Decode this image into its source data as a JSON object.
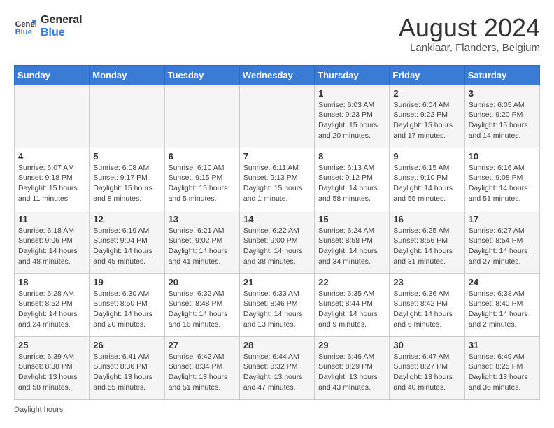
{
  "header": {
    "logo_line1": "General",
    "logo_line2": "Blue",
    "month_year": "August 2024",
    "location": "Lanklaar, Flanders, Belgium"
  },
  "weekdays": [
    "Sunday",
    "Monday",
    "Tuesday",
    "Wednesday",
    "Thursday",
    "Friday",
    "Saturday"
  ],
  "weeks": [
    [
      {
        "day": "",
        "info": ""
      },
      {
        "day": "",
        "info": ""
      },
      {
        "day": "",
        "info": ""
      },
      {
        "day": "",
        "info": ""
      },
      {
        "day": "1",
        "info": "Sunrise: 6:03 AM\nSunset: 9:23 PM\nDaylight: 15 hours\nand 20 minutes."
      },
      {
        "day": "2",
        "info": "Sunrise: 6:04 AM\nSunset: 9:22 PM\nDaylight: 15 hours\nand 17 minutes."
      },
      {
        "day": "3",
        "info": "Sunrise: 6:05 AM\nSunset: 9:20 PM\nDaylight: 15 hours\nand 14 minutes."
      }
    ],
    [
      {
        "day": "4",
        "info": "Sunrise: 6:07 AM\nSunset: 9:18 PM\nDaylight: 15 hours\nand 11 minutes."
      },
      {
        "day": "5",
        "info": "Sunrise: 6:08 AM\nSunset: 9:17 PM\nDaylight: 15 hours\nand 8 minutes."
      },
      {
        "day": "6",
        "info": "Sunrise: 6:10 AM\nSunset: 9:15 PM\nDaylight: 15 hours\nand 5 minutes."
      },
      {
        "day": "7",
        "info": "Sunrise: 6:11 AM\nSunset: 9:13 PM\nDaylight: 15 hours\nand 1 minute."
      },
      {
        "day": "8",
        "info": "Sunrise: 6:13 AM\nSunset: 9:12 PM\nDaylight: 14 hours\nand 58 minutes."
      },
      {
        "day": "9",
        "info": "Sunrise: 6:15 AM\nSunset: 9:10 PM\nDaylight: 14 hours\nand 55 minutes."
      },
      {
        "day": "10",
        "info": "Sunrise: 6:16 AM\nSunset: 9:08 PM\nDaylight: 14 hours\nand 51 minutes."
      }
    ],
    [
      {
        "day": "11",
        "info": "Sunrise: 6:18 AM\nSunset: 9:06 PM\nDaylight: 14 hours\nand 48 minutes."
      },
      {
        "day": "12",
        "info": "Sunrise: 6:19 AM\nSunset: 9:04 PM\nDaylight: 14 hours\nand 45 minutes."
      },
      {
        "day": "13",
        "info": "Sunrise: 6:21 AM\nSunset: 9:02 PM\nDaylight: 14 hours\nand 41 minutes."
      },
      {
        "day": "14",
        "info": "Sunrise: 6:22 AM\nSunset: 9:00 PM\nDaylight: 14 hours\nand 38 minutes."
      },
      {
        "day": "15",
        "info": "Sunrise: 6:24 AM\nSunset: 8:58 PM\nDaylight: 14 hours\nand 34 minutes."
      },
      {
        "day": "16",
        "info": "Sunrise: 6:25 AM\nSunset: 8:56 PM\nDaylight: 14 hours\nand 31 minutes."
      },
      {
        "day": "17",
        "info": "Sunrise: 6:27 AM\nSunset: 8:54 PM\nDaylight: 14 hours\nand 27 minutes."
      }
    ],
    [
      {
        "day": "18",
        "info": "Sunrise: 6:28 AM\nSunset: 8:52 PM\nDaylight: 14 hours\nand 24 minutes."
      },
      {
        "day": "19",
        "info": "Sunrise: 6:30 AM\nSunset: 8:50 PM\nDaylight: 14 hours\nand 20 minutes."
      },
      {
        "day": "20",
        "info": "Sunrise: 6:32 AM\nSunset: 8:48 PM\nDaylight: 14 hours\nand 16 minutes."
      },
      {
        "day": "21",
        "info": "Sunrise: 6:33 AM\nSunset: 8:46 PM\nDaylight: 14 hours\nand 13 minutes."
      },
      {
        "day": "22",
        "info": "Sunrise: 6:35 AM\nSunset: 8:44 PM\nDaylight: 14 hours\nand 9 minutes."
      },
      {
        "day": "23",
        "info": "Sunrise: 6:36 AM\nSunset: 8:42 PM\nDaylight: 14 hours\nand 6 minutes."
      },
      {
        "day": "24",
        "info": "Sunrise: 6:38 AM\nSunset: 8:40 PM\nDaylight: 14 hours\nand 2 minutes."
      }
    ],
    [
      {
        "day": "25",
        "info": "Sunrise: 6:39 AM\nSunset: 8:38 PM\nDaylight: 13 hours\nand 58 minutes."
      },
      {
        "day": "26",
        "info": "Sunrise: 6:41 AM\nSunset: 8:36 PM\nDaylight: 13 hours\nand 55 minutes."
      },
      {
        "day": "27",
        "info": "Sunrise: 6:42 AM\nSunset: 8:34 PM\nDaylight: 13 hours\nand 51 minutes."
      },
      {
        "day": "28",
        "info": "Sunrise: 6:44 AM\nSunset: 8:32 PM\nDaylight: 13 hours\nand 47 minutes."
      },
      {
        "day": "29",
        "info": "Sunrise: 6:46 AM\nSunset: 8:29 PM\nDaylight: 13 hours\nand 43 minutes."
      },
      {
        "day": "30",
        "info": "Sunrise: 6:47 AM\nSunset: 8:27 PM\nDaylight: 13 hours\nand 40 minutes."
      },
      {
        "day": "31",
        "info": "Sunrise: 6:49 AM\nSunset: 8:25 PM\nDaylight: 13 hours\nand 36 minutes."
      }
    ]
  ],
  "footer": {
    "note": "Daylight hours"
  }
}
